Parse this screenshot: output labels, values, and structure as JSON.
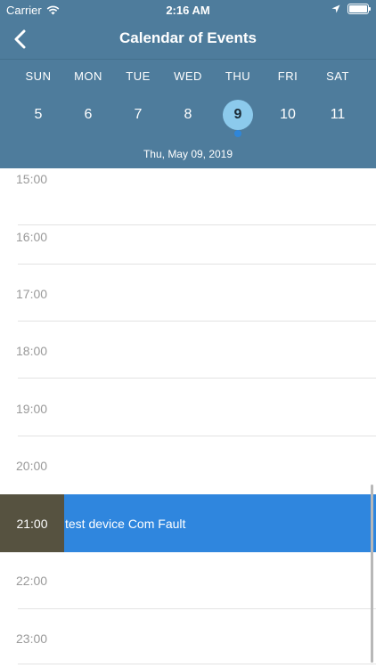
{
  "status_bar": {
    "carrier": "Carrier",
    "time": "2:16 AM"
  },
  "nav": {
    "title": "Calendar of Events"
  },
  "week": {
    "weekdays": [
      "SUN",
      "MON",
      "TUE",
      "WED",
      "THU",
      "FRI",
      "SAT"
    ],
    "dates": [
      "5",
      "6",
      "7",
      "8",
      "9",
      "10",
      "11"
    ],
    "selected_date": "9",
    "selected_date_text": "Thu, May 09, 2019"
  },
  "timeline": {
    "hours": [
      "15:00",
      "16:00",
      "17:00",
      "18:00",
      "19:00",
      "20:00",
      "21:00",
      "22:00",
      "23:00"
    ]
  },
  "event": {
    "time": "21:00",
    "title": "test device Com Fault"
  },
  "colors": {
    "header_bg": "#4e7c9c",
    "selected_date_bg": "#8ccaec",
    "event_dot": "#2f86d9",
    "event_bg": "#2f86de",
    "event_time_bg": "#565240"
  }
}
